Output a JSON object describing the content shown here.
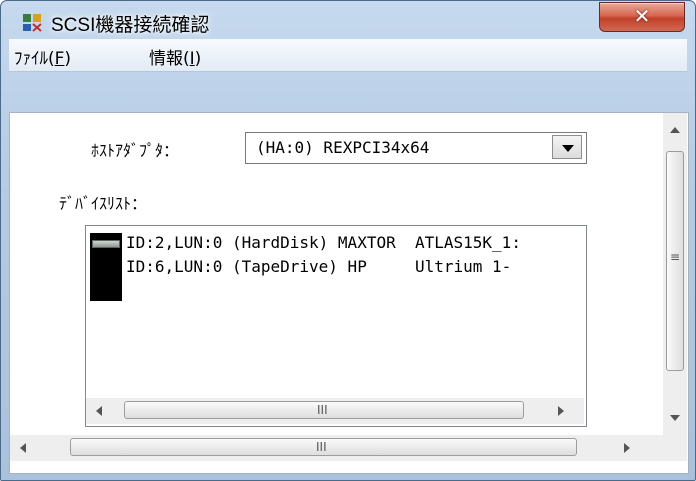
{
  "window": {
    "title": "SCSI機器接続確認",
    "close_glyph": "✕",
    "colors": {
      "title_bg": "#b4cbe4",
      "close_bg": "#c2402a",
      "client_bg": "#ffffff"
    }
  },
  "menu": [
    {
      "text": "ﾌｧｲﾙ(",
      "mnemonic": "F",
      "close": ")"
    },
    {
      "text": "情報(",
      "mnemonic": "I",
      "close": ")"
    }
  ],
  "host_adapter": {
    "label": "ﾎｽﾄｱﾀﾞﾌﾟﾀ：",
    "value": "(HA:0) REXPCI34x64"
  },
  "device_list": {
    "label": "ﾃﾞﾊﾞｲｽﾘｽﾄ：",
    "items": [
      {
        "icon": "hard-disk-icon",
        "text": "ID:2,LUN:0 (HardDisk) MAXTOR  ATLAS15K_1:"
      },
      {
        "icon": "tape-drive-icon",
        "text": "ID:6,LUN:0 (TapeDrive) HP     Ultrium 1-"
      }
    ]
  },
  "scrollbars": {
    "grip": "III",
    "vgrip": "≡"
  }
}
